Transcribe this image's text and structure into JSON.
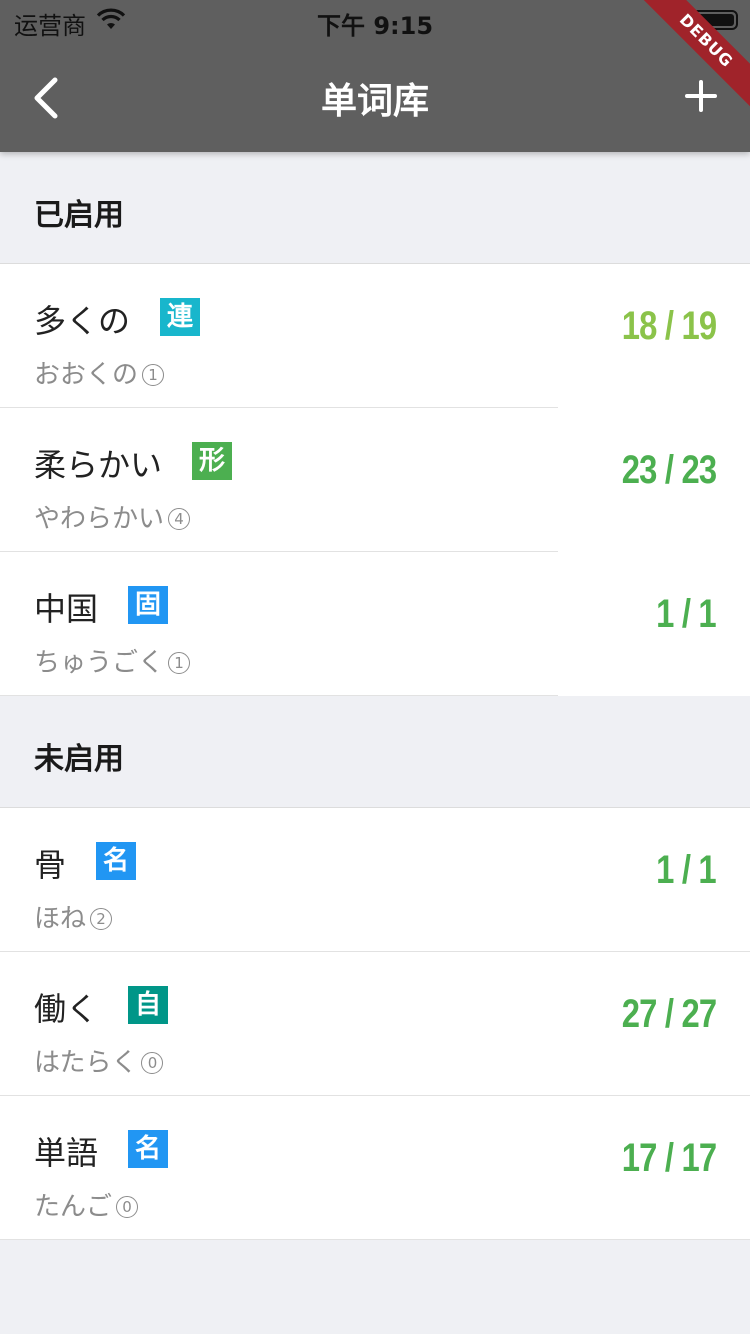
{
  "status_bar": {
    "carrier": "运营商",
    "time": "下午 9:15"
  },
  "app_bar": {
    "title": "单词库",
    "debug_banner": "DEBUG"
  },
  "sections": [
    {
      "header": "已启用",
      "items": [
        {
          "word": "多くの",
          "badge": "連",
          "badge_color": "#18b6cc",
          "reading": "おおくの",
          "accent": "1",
          "count": "18 / 19",
          "count_color": "#8bc34a"
        },
        {
          "word": "柔らかい",
          "badge": "形",
          "badge_color": "#4caf50",
          "reading": "やわらかい",
          "accent": "4",
          "count": "23 / 23",
          "count_color": "#4caf50"
        },
        {
          "word": "中国",
          "badge": "固",
          "badge_color": "#2196f3",
          "reading": "ちゅうごく",
          "accent": "1",
          "count": "1 / 1",
          "count_color": "#4caf50"
        }
      ]
    },
    {
      "header": "未启用",
      "items": [
        {
          "word": "骨",
          "badge": "名",
          "badge_color": "#2196f3",
          "reading": "ほね",
          "accent": "2",
          "count": "1 / 1",
          "count_color": "#4caf50"
        },
        {
          "word": "働く",
          "badge": "自",
          "badge_color": "#009688",
          "reading": "はたらく",
          "accent": "0",
          "count": "27 / 27",
          "count_color": "#4caf50"
        },
        {
          "word": "単語",
          "badge": "名",
          "badge_color": "#2196f3",
          "reading": "たんご",
          "accent": "0",
          "count": "17 / 17",
          "count_color": "#4caf50"
        }
      ]
    }
  ],
  "icons": {
    "back": "chevron-left-icon",
    "add": "plus-icon",
    "wifi": "wifi-icon",
    "battery": "battery-icon"
  }
}
